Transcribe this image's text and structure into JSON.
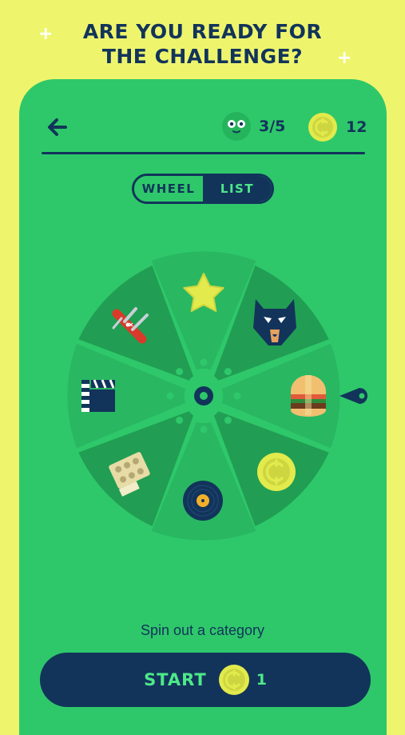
{
  "header": {
    "title_line1": "ARE YOU READY FOR",
    "title_line2": "THE CHALLENGE?"
  },
  "stats": {
    "lives": "3/5",
    "coins": "12"
  },
  "toggle": {
    "wheel_label": "WHEEL",
    "list_label": "LIST",
    "selected": "WHEEL"
  },
  "wheel": {
    "categories": [
      {
        "name": "star-icon"
      },
      {
        "name": "bat-mask-icon"
      },
      {
        "name": "burger-icon"
      },
      {
        "name": "coin-icon"
      },
      {
        "name": "vinyl-record-icon"
      },
      {
        "name": "chocolates-icon"
      },
      {
        "name": "clapperboard-icon"
      },
      {
        "name": "pocket-knife-icon"
      }
    ]
  },
  "caption": "Spin out a category",
  "start_button": {
    "label": "START",
    "cost": "1"
  },
  "colors": {
    "background": "#eef56d",
    "card": "#2ec86a",
    "navy": "#12345a",
    "accent_green": "#4ee88a",
    "coin_yellow": "#e2ea4c"
  }
}
